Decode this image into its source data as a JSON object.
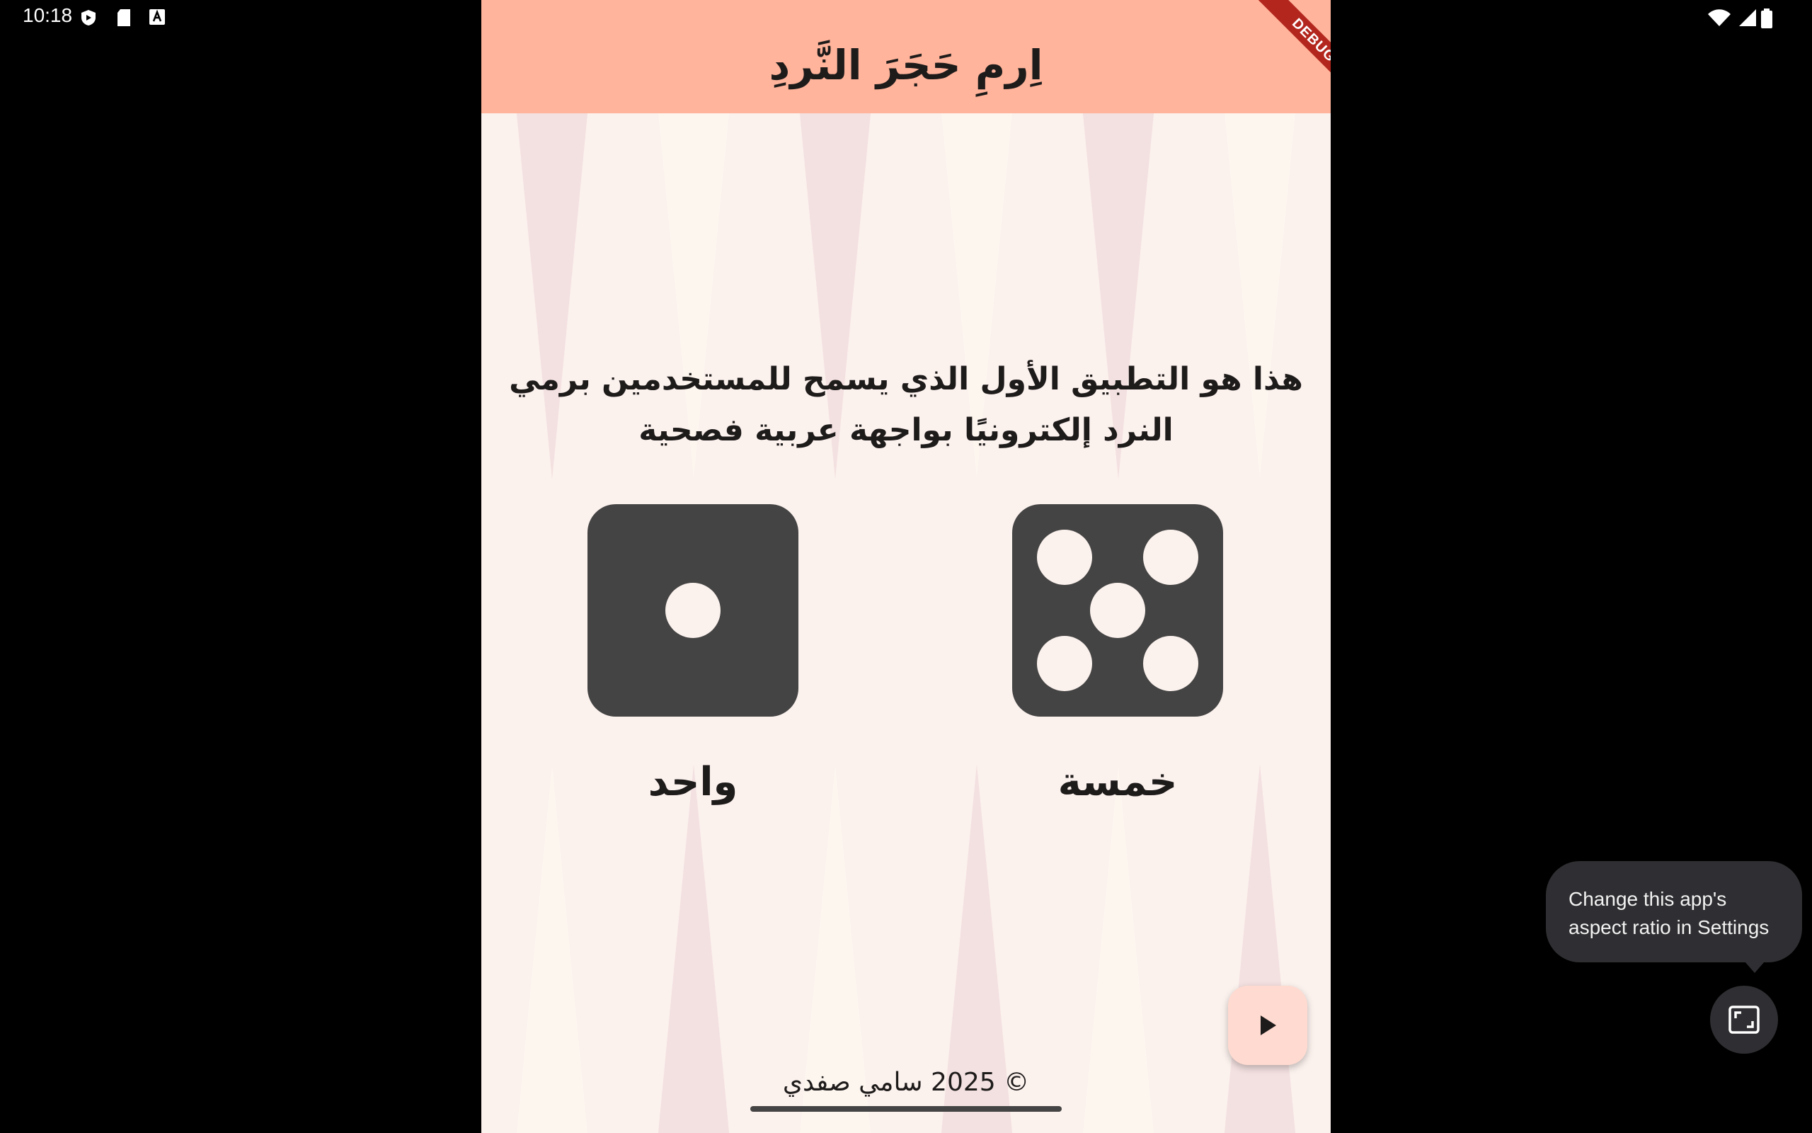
{
  "status_bar": {
    "time": "10:18",
    "left_icons": [
      "shield-play-icon",
      "sd-card-icon",
      "keyboard-a-icon"
    ],
    "right_icons": [
      "wifi-icon",
      "signal-icon",
      "battery-icon"
    ]
  },
  "app_bar": {
    "title": "اِرمِ حَجَرَ النَّردِ",
    "debug_banner": "DEBUG",
    "color": "#ffb49b"
  },
  "intro": {
    "text": "هذا هو التطبيق الأول الذي يسمح للمستخدمين برمي النرد إلكترونيًا بواجهة عربية فصحية"
  },
  "dice": [
    {
      "value": 1,
      "label": "واحد"
    },
    {
      "value": 5,
      "label": "خمسة"
    }
  ],
  "fab": {
    "icon": "play-icon"
  },
  "footer": {
    "text": "© 2025 سامي صفدي"
  },
  "tooltip": {
    "text": "Change this app's aspect ratio in Settings"
  },
  "aspect_button": {
    "icon": "aspect-ratio-icon"
  },
  "colors": {
    "background": "#fbf1ed",
    "die": "#444444",
    "accent": "#ffdad0",
    "triangle_pink": "#f3e0e0",
    "triangle_cream": "#fdf6ef"
  }
}
